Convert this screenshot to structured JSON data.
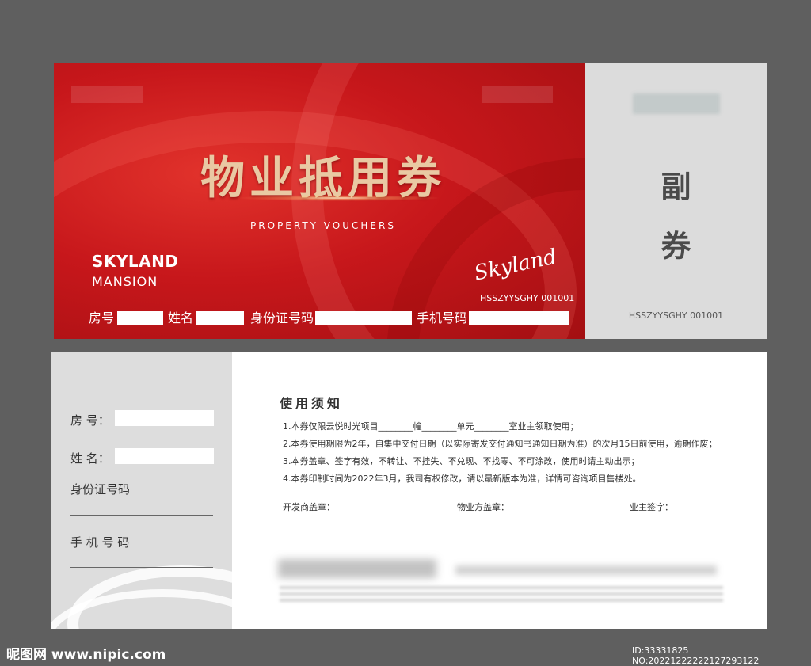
{
  "front": {
    "title": "物业抵用券",
    "subtitle": "PROPERTY VOUCHERS",
    "brand_line1": "SKYLAND",
    "brand_line2": "MANSION",
    "script_logo": "Skyland",
    "serial": "HSSZYYSGHY 001001",
    "fields": {
      "room": "房号",
      "name": "姓名",
      "id_number": "身份证号码",
      "phone": "手机号码"
    }
  },
  "stub": {
    "char1": "副",
    "char2": "券",
    "serial": "HSSZYYSGHY 001001"
  },
  "back": {
    "fields": {
      "room": "房  号：",
      "name": "姓  名：",
      "id_number": "身份证号码",
      "phone": "手 机 号 码"
    },
    "notice_title": "使用须知",
    "rules": [
      "1.本券仅限云悦时光项目________幢________单元________室业主领取使用；",
      "2.本券使用期限为2年，自集中交付日期（以实际寄发交付通知书通知日期为准）的次月15日前使用，逾期作废；",
      "3.本券盖章、签字有效，不转让、不挂失、不兑现、不找零、不可涂改，使用时请主动出示；",
      "4.本券印制时间为2022年3月，我司有权修改，请以最新版本为准，详情可咨询项目售楼处。"
    ],
    "signatures": {
      "developer": "开发商盖章：",
      "property": "物业方盖章：",
      "owner": "业主签字："
    }
  },
  "watermark": {
    "site": "昵图网 www.nipic.com",
    "id": "ID:33331825 NO:20221222222127293122"
  },
  "colors": {
    "background": "#5f5f5f",
    "voucher_red": "#c7171b",
    "gold_text": "#e9c9a3",
    "stub_gray": "#dcdcdc"
  }
}
